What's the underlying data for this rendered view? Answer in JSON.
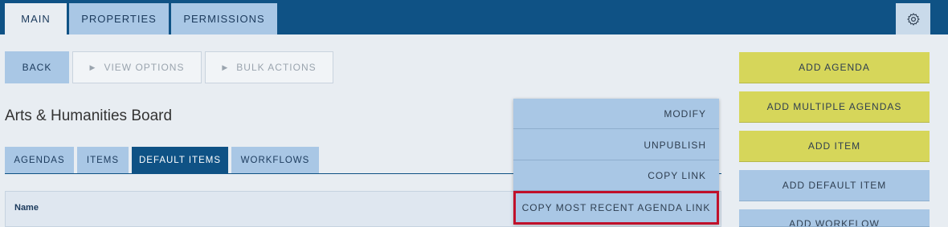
{
  "top_tabs": [
    {
      "label": "MAIN"
    },
    {
      "label": "PROPERTIES"
    },
    {
      "label": "PERMISSIONS"
    }
  ],
  "settings_icon": "gear-icon",
  "toolbar": {
    "back": "BACK",
    "view_options": "VIEW OPTIONS",
    "bulk_actions": "BULK ACTIONS",
    "expand_icon": "triangle-right-icon"
  },
  "board_title": "Arts & Humanities Board",
  "sub_tabs": [
    {
      "label": "AGENDAS"
    },
    {
      "label": "ITEMS"
    },
    {
      "label": "DEFAULT ITEMS"
    },
    {
      "label": "WORKFLOWS"
    }
  ],
  "table": {
    "columns": [
      "Name"
    ]
  },
  "dropdown": {
    "items": [
      "MODIFY",
      "UNPUBLISH",
      "COPY LINK",
      "COPY MOST RECENT AGENDA LINK"
    ]
  },
  "side_buttons": [
    "ADD AGENDA",
    "ADD MULTIPLE AGENDAS",
    "ADD ITEM",
    "ADD DEFAULT ITEM",
    "ADD WORKFLOW"
  ],
  "colors": {
    "brand": "#0f5285",
    "tab": "#a9c7e5",
    "accent_yellow": "#d6d65a",
    "highlight": "#c0102a"
  }
}
